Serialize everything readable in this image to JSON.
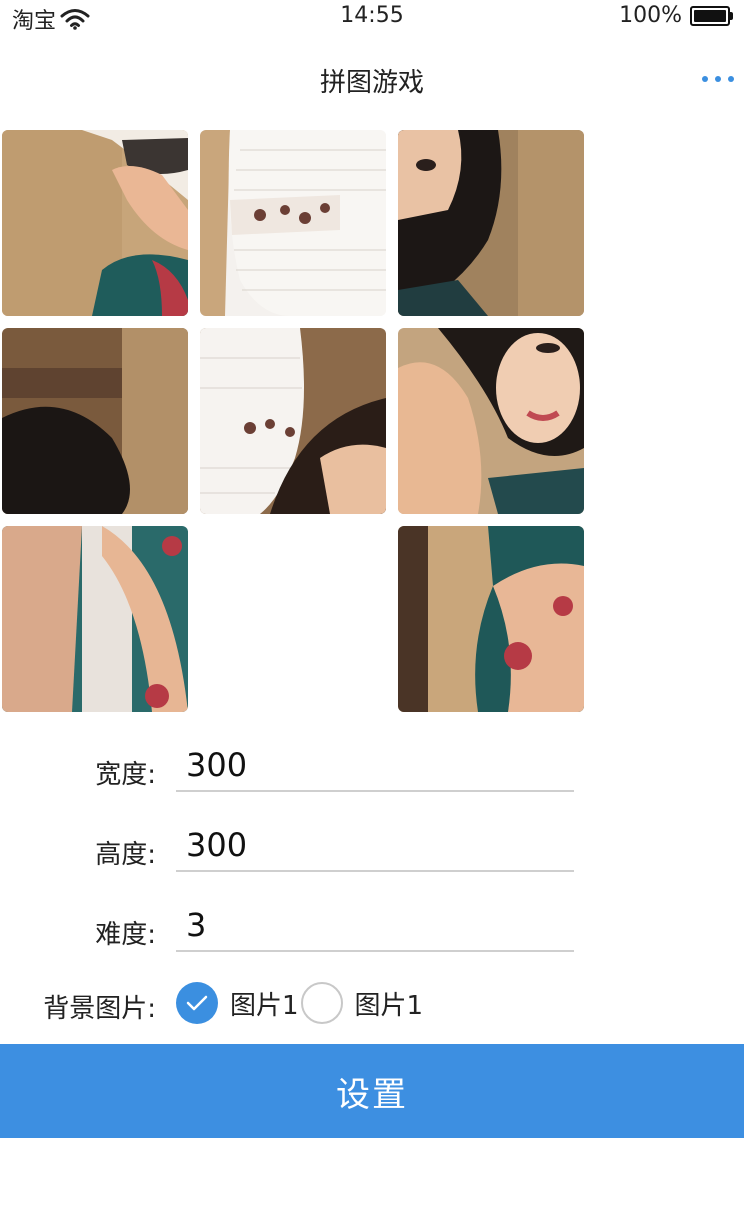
{
  "status_bar": {
    "carrier": "淘宝",
    "time": "14:55",
    "battery_text": "100%",
    "wifi_icon": "wifi-icon",
    "battery_icon": "battery-full-icon"
  },
  "nav": {
    "title": "拼图游戏",
    "more_icon": "more-dots-icon"
  },
  "puzzle": {
    "rows": 3,
    "cols": 3,
    "tiles": [
      "tile-1",
      "tile-2",
      "tile-3",
      "tile-4",
      "tile-5",
      "tile-6",
      "tile-7",
      "empty",
      "tile-9"
    ]
  },
  "form": {
    "width_label": "宽度:",
    "width_value": "300",
    "height_label": "高度:",
    "height_value": "300",
    "difficulty_label": "难度:",
    "difficulty_value": "3",
    "background_label": "背景图片:",
    "background_options": [
      {
        "label": "图片1",
        "checked": true
      },
      {
        "label": "图片1",
        "checked": false
      }
    ]
  },
  "submit_button": "设置",
  "colors": {
    "accent": "#3d8fe1",
    "more_dots": "#3b8fe0"
  }
}
